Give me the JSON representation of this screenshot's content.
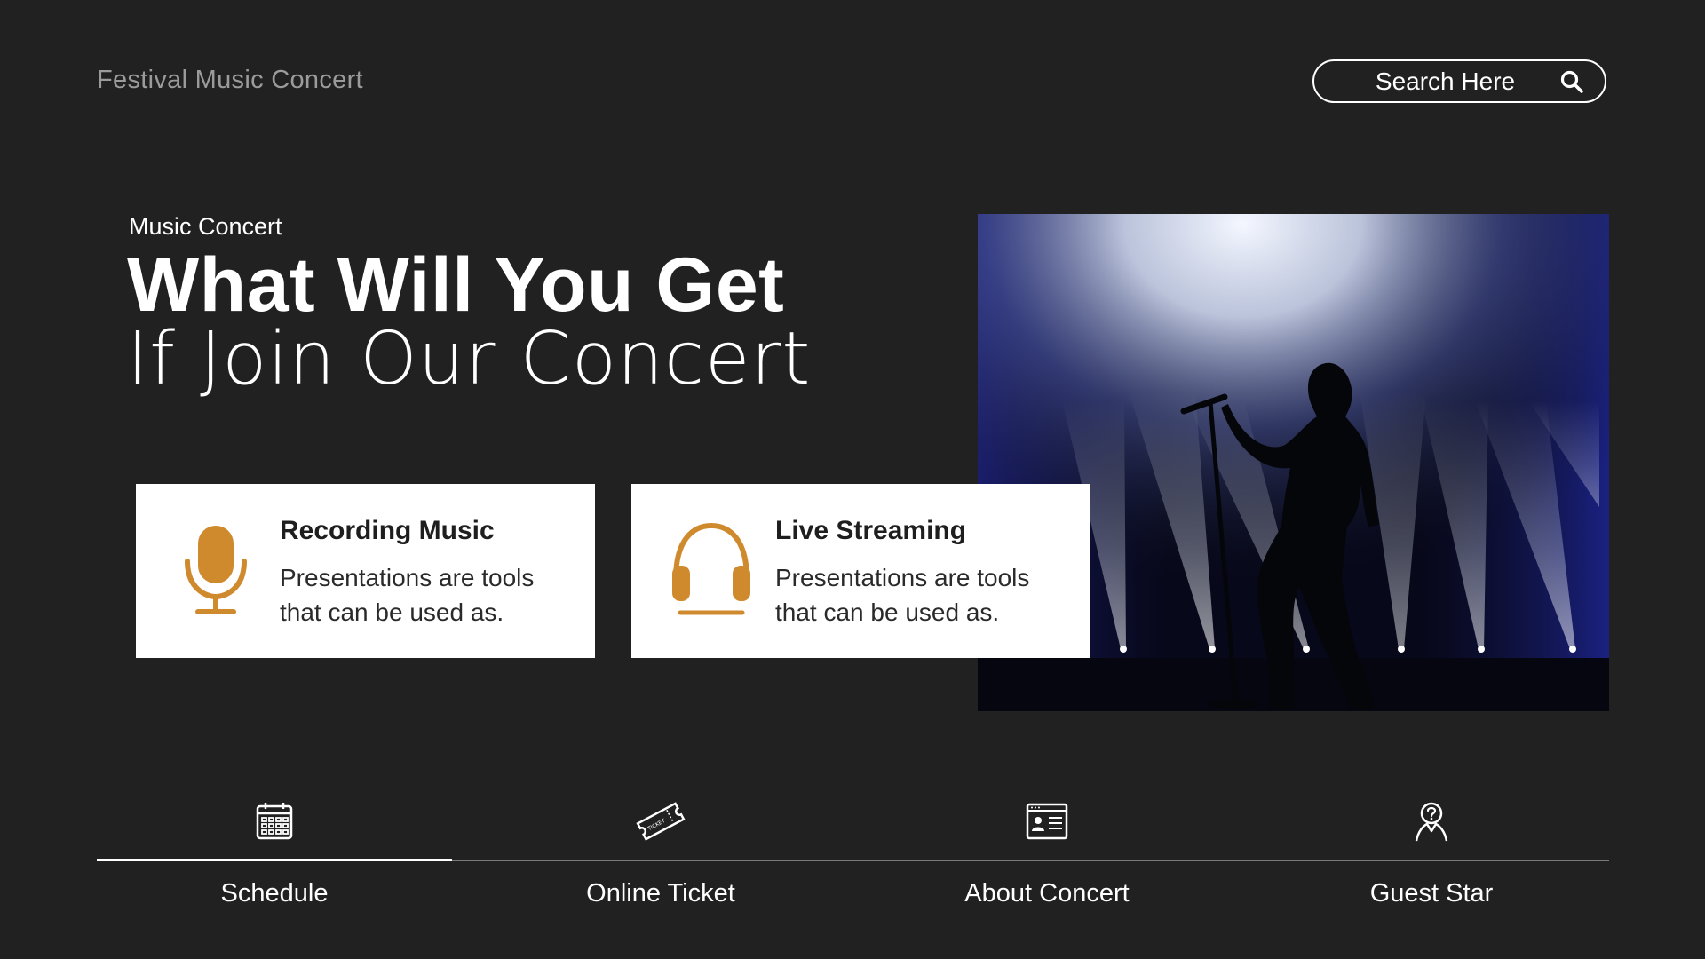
{
  "header": {
    "brand": "Festival Music Concert",
    "search_placeholder": "Search Here"
  },
  "hero": {
    "eyebrow": "Music Concert",
    "headline_bold": "What Will You Get",
    "headline_light": "If Join Our Concert",
    "image": "concert-singer-photo"
  },
  "features": [
    {
      "title": "Recording Music",
      "description": "Presentations are tools that can be used as.",
      "icon": "microphone-icon"
    },
    {
      "title": "Live Streaming",
      "description": "Presentations are tools that can be used as.",
      "icon": "headphones-icon"
    }
  ],
  "tabs": [
    {
      "label": "Schedule",
      "icon": "calendar-icon",
      "active": true
    },
    {
      "label": "Online Ticket",
      "icon": "ticket-icon",
      "active": false
    },
    {
      "label": "About Concert",
      "icon": "id-card-icon",
      "active": false
    },
    {
      "label": "Guest Star",
      "icon": "guest-star-icon",
      "active": false
    }
  ],
  "colors": {
    "background": "#212121",
    "accent": "#D08A2E",
    "card": "#FFFFFF"
  }
}
